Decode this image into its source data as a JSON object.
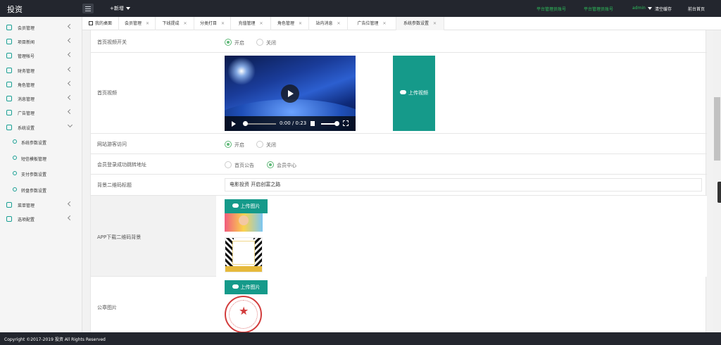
{
  "app": {
    "logo": "投资",
    "new_label": "+新增"
  },
  "header_links": [
    {
      "label": "平台管理员账号",
      "color": "#2ec05c"
    },
    {
      "label": "平台管理员账号",
      "color": "#2ec05c"
    },
    {
      "label": "admin",
      "color": "#2ec05c"
    }
  ],
  "header_actions": {
    "clear_cache": "清空缓存",
    "frontend": "前台首页"
  },
  "sidebar": {
    "items": [
      {
        "label": "会员管理"
      },
      {
        "label": "项目新闻"
      },
      {
        "label": "管理帐号"
      },
      {
        "label": "财务管理"
      },
      {
        "label": "角色管理"
      },
      {
        "label": "消息管理"
      },
      {
        "label": "广告管理"
      },
      {
        "label": "系统设置"
      }
    ],
    "subitems": [
      {
        "label": "系统参数设置"
      },
      {
        "label": "短信模板管理"
      },
      {
        "label": "支付参数设置"
      },
      {
        "label": "转盘参数设置"
      }
    ],
    "bottom_items": [
      {
        "label": "菜单管理"
      },
      {
        "label": "选项配置"
      }
    ]
  },
  "tabs": [
    {
      "label": "我的桌面"
    },
    {
      "label": "会员管理"
    },
    {
      "label": "下线提成"
    },
    {
      "label": "分类打目"
    },
    {
      "label": "充值管理"
    },
    {
      "label": "角色管理"
    },
    {
      "label": "站内消息"
    },
    {
      "label": "广告位管理"
    },
    {
      "label": "系统参数设置"
    }
  ],
  "form": {
    "home_video_switch": {
      "label": "首页视频开关",
      "on": "开启",
      "off": "关闭",
      "value": "开启"
    },
    "home_video": {
      "label": "首页视频",
      "time": "0:00 / 0:23",
      "upload_label": "上传视频"
    },
    "site_visitor": {
      "label": "网站游客访问",
      "on": "开启",
      "off": "关闭",
      "value": "开启"
    },
    "login_redirect": {
      "label": "会员登录成功跳转地址",
      "opt1": "首页公告",
      "opt2": "会员中心",
      "value": "会员中心"
    },
    "qr_title": {
      "label": "背景二维码标题",
      "value": "电影投资 开启创富之路"
    },
    "app_qr_bg": {
      "label": "APP下载二维码背景",
      "upload_label": "上传图片"
    },
    "seal_image": {
      "label": "公章图片",
      "upload_label": "上传图片"
    }
  },
  "footer": {
    "copyright": "Copyright ©2017-2019 投资 All Rights Reserved"
  },
  "colors": {
    "accent": "#159a8a",
    "radio_active": "#5fb878",
    "topbar": "#23262e"
  }
}
